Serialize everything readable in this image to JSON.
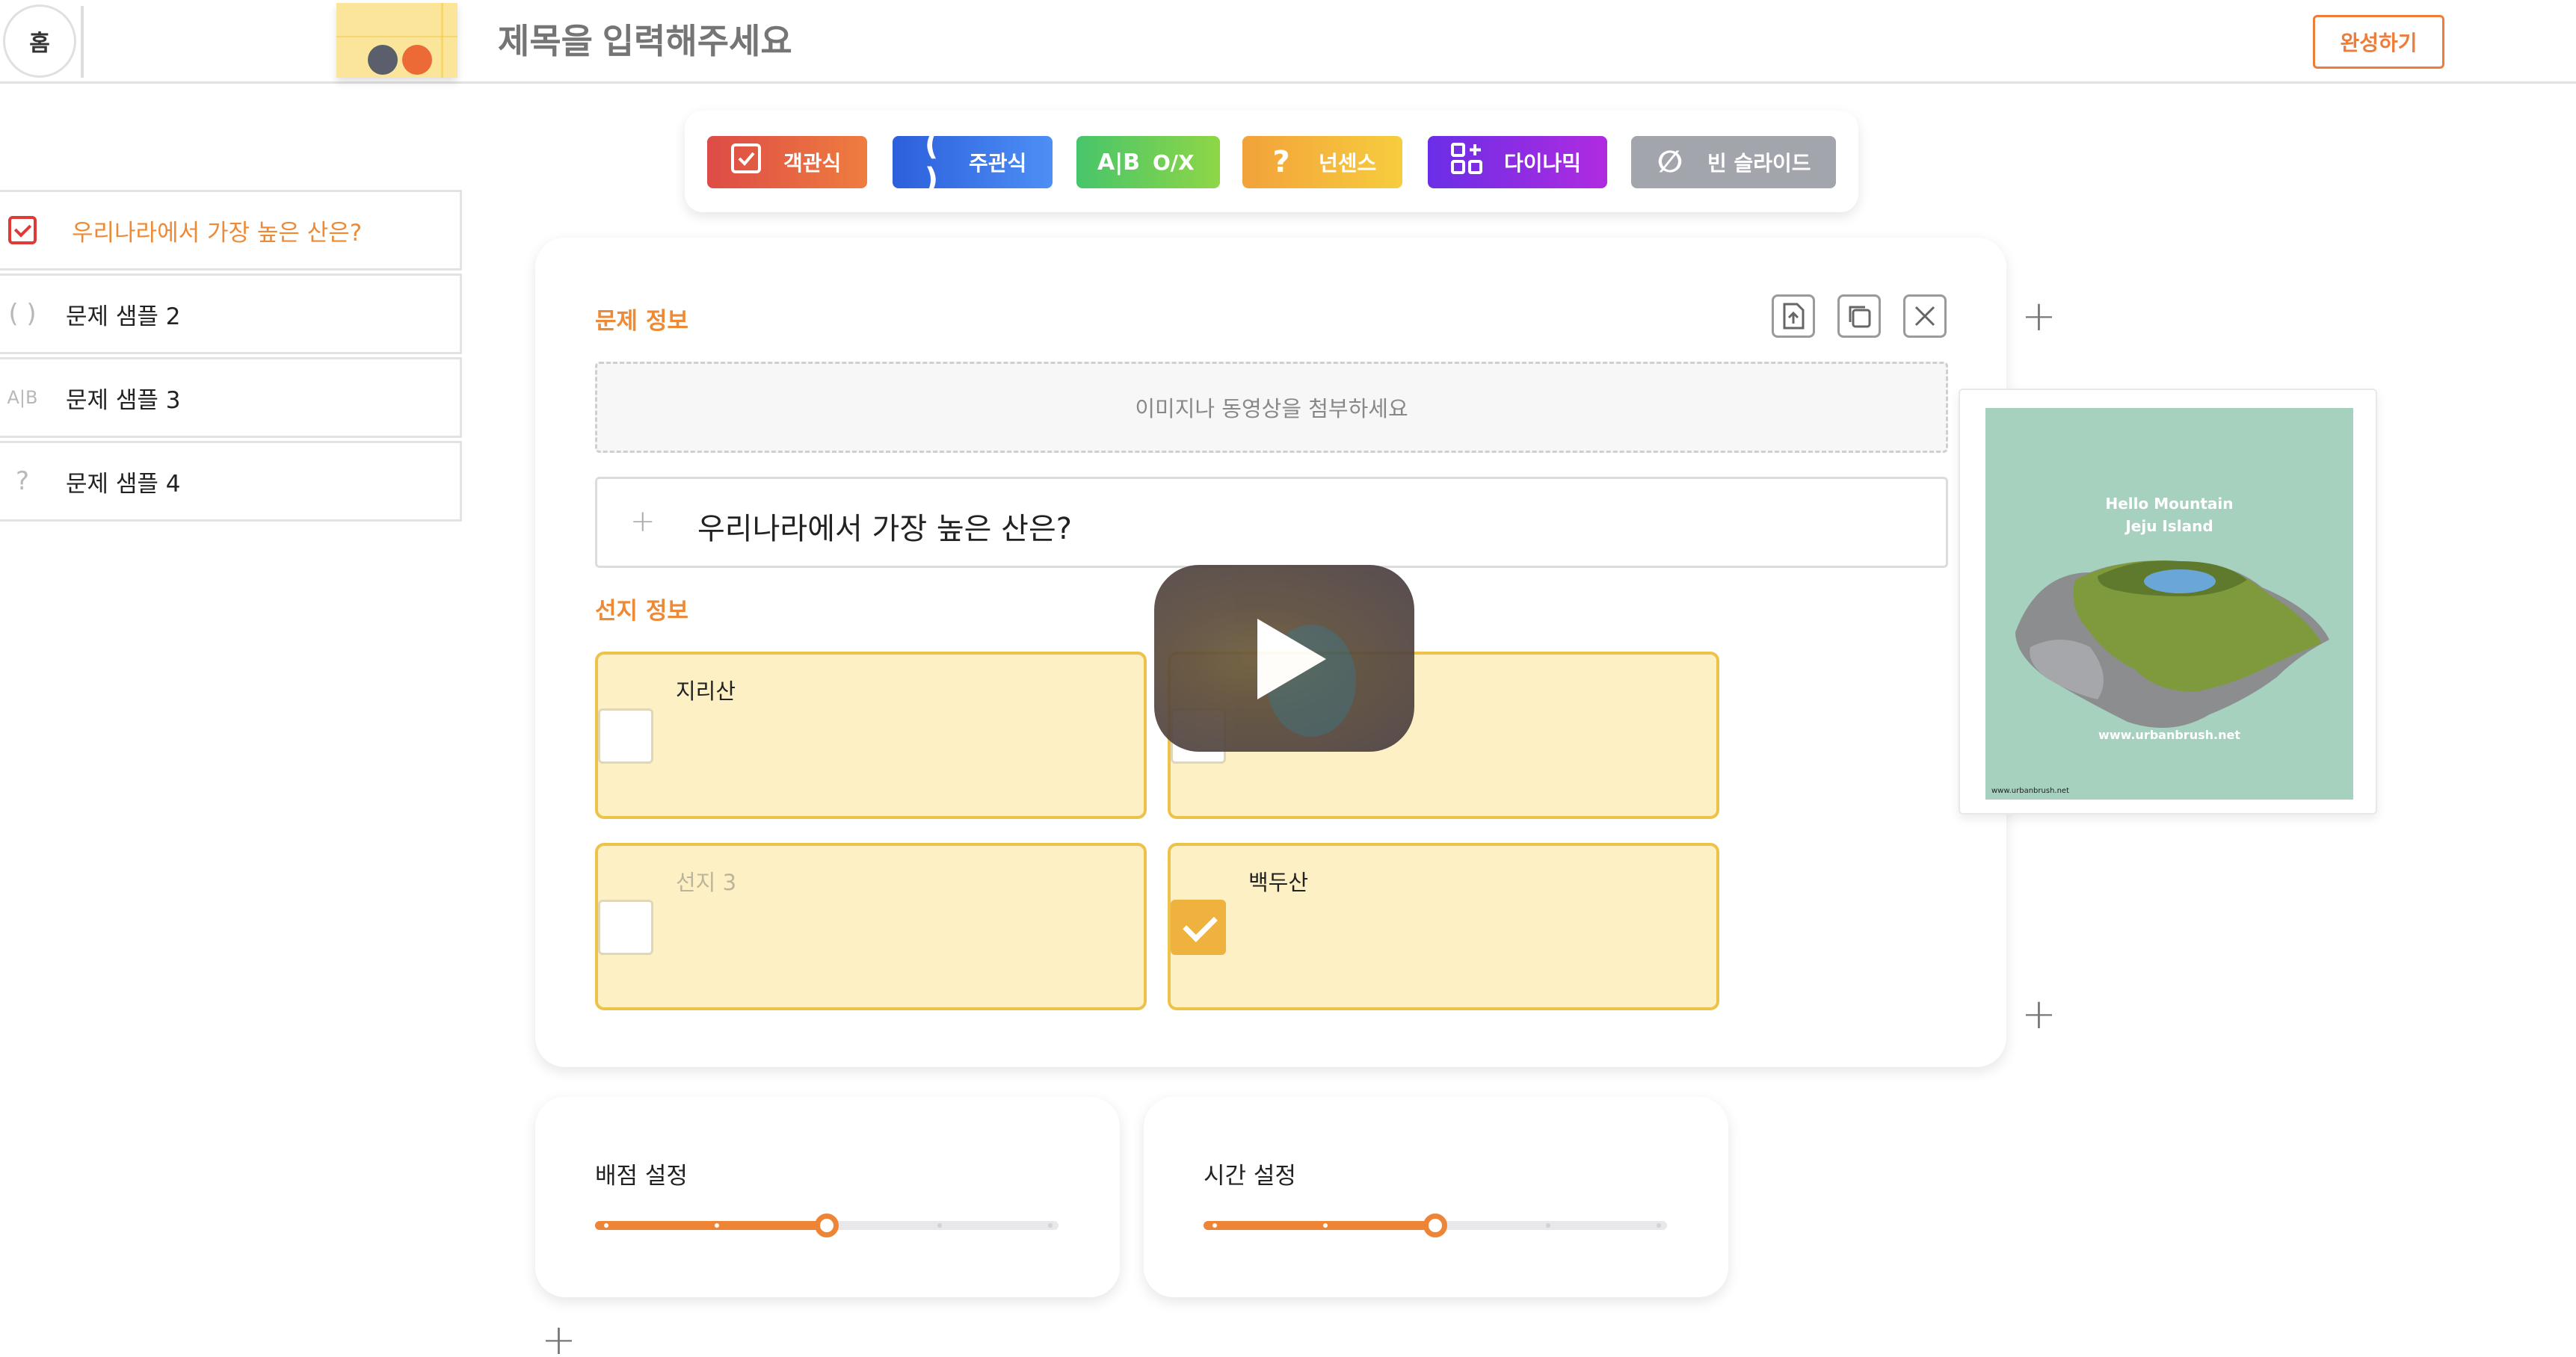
{
  "header": {
    "home_label": "홈",
    "title_placeholder": "제목을 입력해주세요",
    "done_label": "완성하기"
  },
  "toolbar": {
    "types": [
      {
        "label": "객관식",
        "icon": "checkbox-icon"
      },
      {
        "label": "주관식",
        "icon": "parentheses-icon"
      },
      {
        "label": "O/X",
        "icon": "ab-icon",
        "icon_text": "A|B"
      },
      {
        "label": "넌센스",
        "icon": "question-mark-icon",
        "icon_text": "?"
      },
      {
        "label": "다이나믹",
        "icon": "grid-plus-icon"
      },
      {
        "label": "빈 슬라이드",
        "icon": "empty-set-icon",
        "icon_text": "∅"
      }
    ],
    "colors": {
      "objective": "#dd4b46",
      "subjective": "#2c5fdb",
      "ox": "#47c56b",
      "nonsense": "#f2a23a",
      "dynamic": "#6a2ee6",
      "blank": "#a3a5ad"
    }
  },
  "sidebar": {
    "items": [
      {
        "label": "우리나라에서 가장 높은 산은?",
        "icon": "checkbox-icon",
        "active": true
      },
      {
        "label": "문제 샘플 2",
        "icon": "parentheses-icon",
        "icon_text": "( )"
      },
      {
        "label": "문제 샘플 3",
        "icon": "ab-icon",
        "icon_text": "A|B"
      },
      {
        "label": "문제 샘플 4",
        "icon": "question-mark-icon",
        "icon_text": "?"
      }
    ]
  },
  "editor": {
    "question_section": "문제 정보",
    "attach_placeholder": "이미지나 동영상을 첨부하세요",
    "question_text": "우리나라에서 가장 높은 산은?",
    "choices_section": "선지 정보",
    "choices": [
      {
        "text": "지리산",
        "checked": false
      },
      {
        "text": "",
        "checked": false
      },
      {
        "text": "선지 3",
        "placeholder": true,
        "checked": false
      },
      {
        "text": "백두산",
        "checked": true
      }
    ]
  },
  "preview": {
    "line1": "Hello Mountain",
    "line2": "Jeju Island",
    "url": "www.urbanbrush.net",
    "small": "www.urbanbrush.net"
  },
  "settings": {
    "score": {
      "label": "배점 설정",
      "level_fraction": 0.5
    },
    "time": {
      "label": "시간 설정",
      "level_fraction": 0.5
    }
  }
}
